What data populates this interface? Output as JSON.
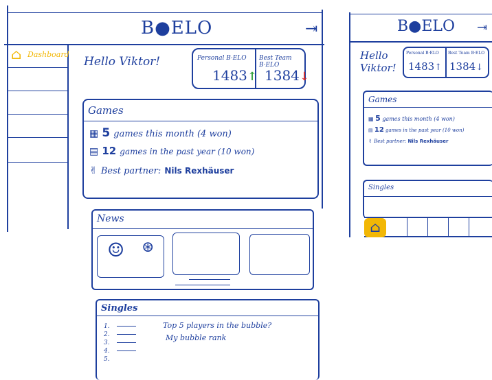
{
  "app": {
    "title": "B●ELO"
  },
  "desktop": {
    "sidebar": {
      "items": [
        {
          "label": "Dashboard"
        },
        {
          "label": ""
        },
        {
          "label": ""
        },
        {
          "label": ""
        },
        {
          "label": ""
        },
        {
          "label": ""
        }
      ]
    },
    "greeting": "Hello Viktor!",
    "stats": {
      "personal_label": "Personal B·ELO",
      "personal_value": "1483",
      "personal_trend": "↑",
      "team_label": "Best Team B·ELO",
      "team_value": "1384",
      "team_trend": "↓"
    },
    "games": {
      "title": "Games",
      "month_count": "5",
      "month_text": "games this month (4 won)",
      "year_count": "12",
      "year_text": "games in the past year (10 won)",
      "partner_label": "Best partner:",
      "partner_name": "Nils Rexhäuser"
    },
    "news": {
      "title": "News"
    },
    "singles": {
      "title": "Singles",
      "ranks": [
        "1.",
        "2.",
        "3.",
        "4.",
        "5."
      ],
      "line1": "Top 5 players in the bubble?",
      "line2": "My bubble rank"
    }
  },
  "mobile": {
    "title": "B●ELO",
    "greeting_line1": "Hello",
    "greeting_line2": "Viktor!",
    "personal_label": "Personal B·ELO",
    "personal_value": "1483",
    "personal_trend": "↑",
    "team_label": "Best Team B·ELO",
    "team_value": "1384",
    "team_trend": "↓",
    "games_title": "Games",
    "month_count": "5",
    "month_text": "games this month (4 won)",
    "year_count": "12",
    "year_text": "games in the past year (10 won)",
    "partner_label": "Best partner:",
    "partner_name": "Nils Rexhäuser",
    "singles_title": "Singles"
  },
  "colors": {
    "ink": "#1e3f9e",
    "highlight": "#f2b705",
    "up": "#2e9e3a",
    "down": "#d62b2b"
  }
}
